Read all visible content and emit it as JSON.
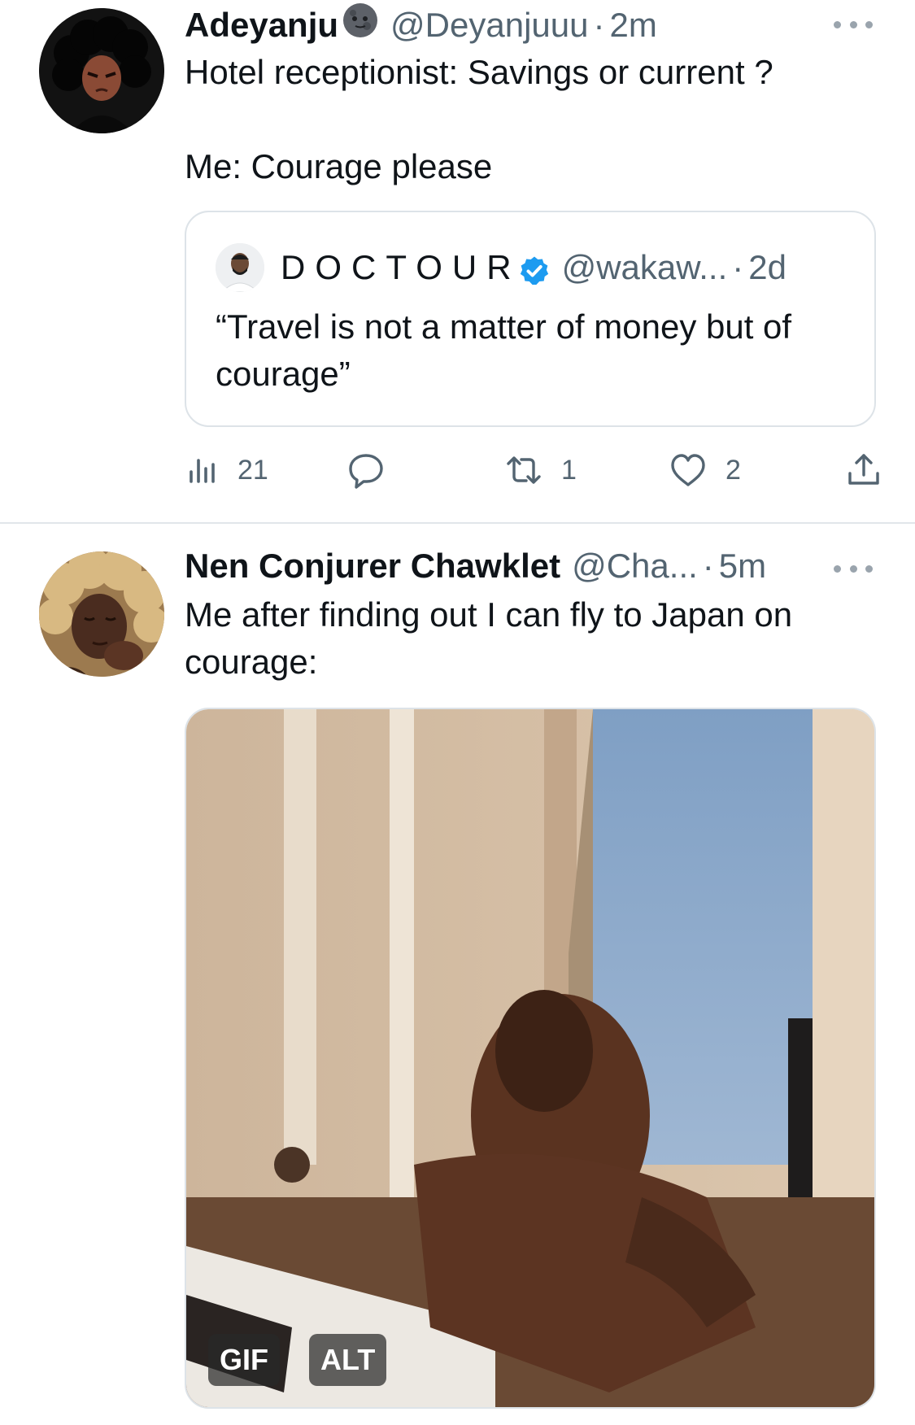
{
  "tweet1": {
    "name": "Adeyanju",
    "handle": "@Deyanjuuu",
    "separator": "·",
    "time": "2m",
    "text": "Hotel receptionist: Savings or current ?\n\nMe: Courage please",
    "quote": {
      "name": "DOCTOUR",
      "handle": "@wakaw...",
      "separator": "·",
      "time": "2d",
      "text": "“Travel is not a matter of money but of courage”"
    },
    "stats": {
      "views": "21",
      "retweets": "1",
      "likes": "2"
    }
  },
  "tweet2": {
    "name": "Nen Conjurer Chawklet",
    "handle": "@Cha...",
    "separator": "·",
    "time": "5m",
    "text": "Me after finding out I can fly to Japan on courage:",
    "media": {
      "gif_label": "GIF",
      "alt_label": "ALT"
    }
  },
  "colors": {
    "accent": "#1d9bf0",
    "muted": "#536471",
    "text": "#0f1419",
    "border": "#e1e6ea"
  },
  "icons": [
    "moon-emoji-icon",
    "verified-badge-icon",
    "more-icon",
    "views-icon",
    "reply-icon",
    "retweet-icon",
    "like-icon",
    "share-icon"
  ]
}
